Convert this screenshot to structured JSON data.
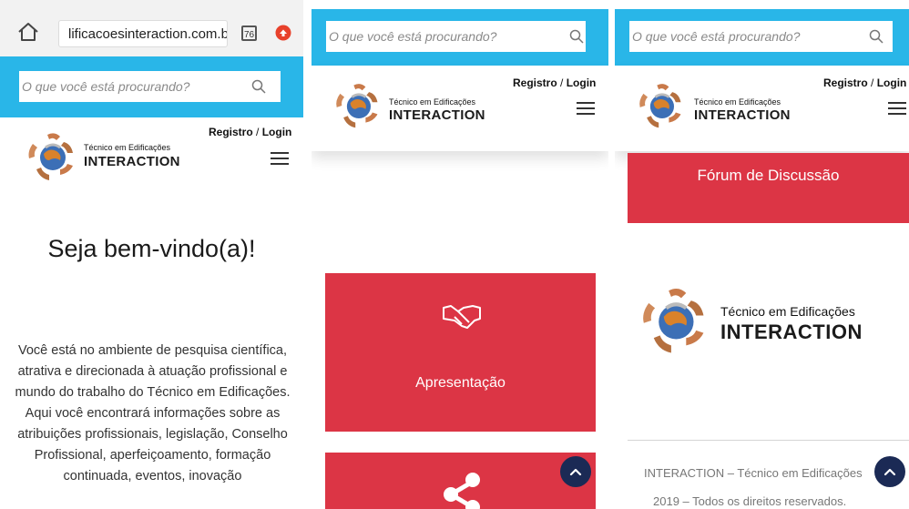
{
  "browser": {
    "url": "lificacoesinteraction.com.br",
    "tab_count": "76"
  },
  "search": {
    "placeholder": "O que você está procurando?"
  },
  "header": {
    "register": "Registro",
    "separator": " / ",
    "login": "Login",
    "brand_sub": "Técnico em Edificações",
    "brand_main": "INTERACTION"
  },
  "home": {
    "welcome": "Seja bem-vindo(a)!",
    "intro": "Você está no ambiente de pesquisa científica, atrativa e direcionada à atuação profissional e mundo do trabalho do Técnico em Edificações. Aqui você encontrará informações sobre as atribuições profissionais, legislação, Conselho Profissional, aperfeiçoamento, formação continuada, eventos, inovação"
  },
  "cards": {
    "apresentacao": "Apresentação",
    "forum": "Fórum de Discussão"
  },
  "footer": {
    "brand_sub": "Técnico em Edificações",
    "brand_main": "INTERACTION",
    "line1": "INTERACTION – Técnico em Edificações",
    "line2": "2019 – Todos os direitos reservados."
  },
  "colors": {
    "cyan": "#29b6e8",
    "card_red": "#dc3545",
    "scroll_button": "#1b2a55"
  },
  "icons": [
    "home-icon",
    "tabs-icon",
    "extension-icon",
    "search-icon",
    "hamburger-menu-icon",
    "handshake-icon",
    "share-icon",
    "chevron-up-icon"
  ]
}
